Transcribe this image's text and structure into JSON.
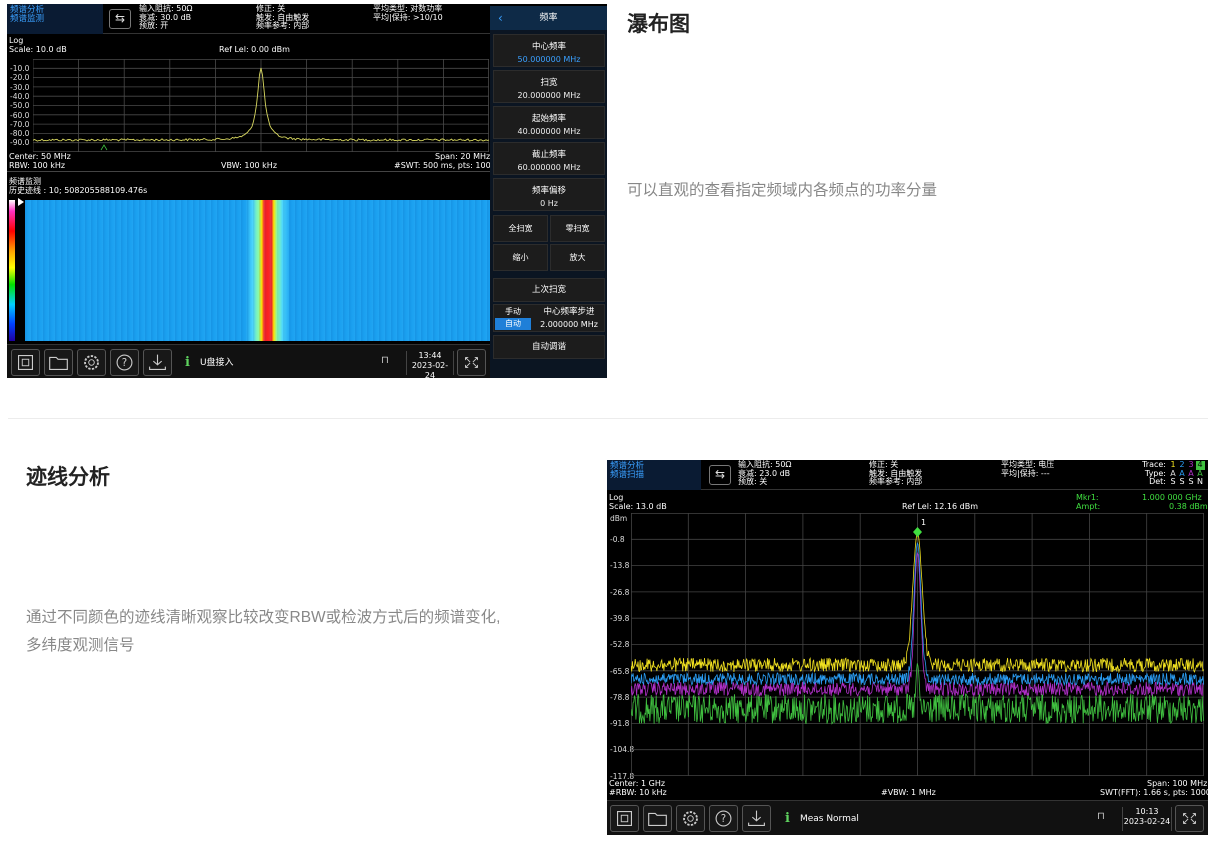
{
  "waterfall_section": {
    "heading": "瀑布图",
    "description": "可以直观的查看指定频域内各频点的功率分量",
    "screen": {
      "mode": [
        "频谱分析",
        "频谱监测"
      ],
      "info_col1": [
        "输入阻抗: 50Ω",
        "衰减: 30.0 dB",
        "预放: 开"
      ],
      "info_col2": [
        "修正: 关",
        "触发: 自由触发",
        "频率参考: 内部"
      ],
      "info_col3": [
        "平均类型: 对数功率",
        "平均|保持: >10/10"
      ],
      "log": "Log",
      "scale": "Scale: 10.0 dB",
      "ref_level": "Ref Lel: 0.00 dBm",
      "y_ticks": [
        "-10.0",
        "-20.0",
        "-30.0",
        "-40.0",
        "-50.0",
        "-60.0",
        "-70.0",
        "-80.0",
        "-90.0"
      ],
      "center": "Center: 50 MHz",
      "span": "Span: 20 MHz",
      "rbw": "RBW: 100 kHz",
      "vbw": "VBW: 100 kHz",
      "swt": "#SWT: 500 ms, pts: 1000",
      "monitor_title": "频谱监测",
      "history": "历史迹线 : 10; 508205588109.476s",
      "message": "U盘接入",
      "time": "13:44",
      "date": "2023-02-24",
      "toolbar_icons": [
        "screenshot-icon",
        "folder-icon",
        "gear-icon",
        "help-icon",
        "download-icon"
      ],
      "menu": {
        "title": "频率",
        "center_freq_label": "中心频率",
        "center_freq_value": "50.000000 MHz",
        "span_label": "扫宽",
        "span_value": "20.000000 MHz",
        "start_label": "起始频率",
        "start_value": "40.000000 MHz",
        "stop_label": "截止频率",
        "stop_value": "60.000000 MHz",
        "offset_label": "频率偏移",
        "offset_value": "0 Hz",
        "full_span": "全扫宽",
        "zero_span": "零扫宽",
        "zoom_out": "缩小",
        "zoom_in": "放大",
        "last_span": "上次扫宽",
        "step_manual": "手动",
        "step_auto": "自动",
        "step_label": "中心频率步进",
        "step_value": "2.000000 MHz",
        "auto_tune": "自动调谐"
      },
      "colors": {
        "trace": "#d8d860",
        "waterfall_bg": "#1aa0f0",
        "peak_core": "#ff2020",
        "accent": "#3aa0ff"
      }
    }
  },
  "trace_section": {
    "heading": "迹线分析",
    "description_lines": [
      "通过不同颜色的迹线清晰观察比较改变RBW或检波方式后的频谱变化,",
      "多纬度观测信号"
    ],
    "screen": {
      "mode": [
        "频谱分析",
        "频谱扫描"
      ],
      "info_col1": [
        "输入阻抗: 50Ω",
        "衰减: 23.0 dB",
        "预放: 关"
      ],
      "info_col2": [
        "修正: 关",
        "触发: 自由触发",
        "频率参考: 内部"
      ],
      "info_col3": [
        "平均类型: 电压",
        "平均|保持: ---"
      ],
      "trace_row_label": "Trace:",
      "trace_numbers": [
        "1",
        "2",
        "3",
        "4"
      ],
      "type_row_label": "Type:",
      "type_values": [
        "A",
        "A",
        "A",
        "A"
      ],
      "det_row_label": "Det:",
      "det_values": [
        "S",
        "S",
        "S",
        "N"
      ],
      "log": "Log",
      "scale": "Scale: 13.0 dB",
      "ref_level": "Ref Lel: 12.16 dBm",
      "marker_label": "Mkr1:",
      "marker_freq": "1.000 000 GHz",
      "ampt_label": "Ampt:",
      "marker_ampt": "0.38 dBm",
      "marker_number": "1",
      "unit": "dBm",
      "y_ticks": [
        "-0.8",
        "-13.8",
        "-26.8",
        "-39.8",
        "-52.8",
        "-65.8",
        "-78.8",
        "-91.8",
        "-104.8",
        "-117.8"
      ],
      "center": "Center: 1 GHz",
      "span": "Span: 100 MHz",
      "rbw": "#RBW: 10 kHz",
      "vbw": "#VBW: 1 MHz",
      "swt": "SWT(FFT): 1.66 s, pts: 10000",
      "message": "Meas Normal",
      "time": "10:13",
      "date": "2023-02-24",
      "toolbar_icons": [
        "screenshot-icon",
        "folder-icon",
        "gear-icon",
        "help-icon",
        "download-icon"
      ],
      "colors": {
        "trace1": "#f0e020",
        "trace2": "#2a9df4",
        "trace3": "#b030c8",
        "trace4": "#40c040",
        "marker": "#40e040"
      }
    }
  }
}
